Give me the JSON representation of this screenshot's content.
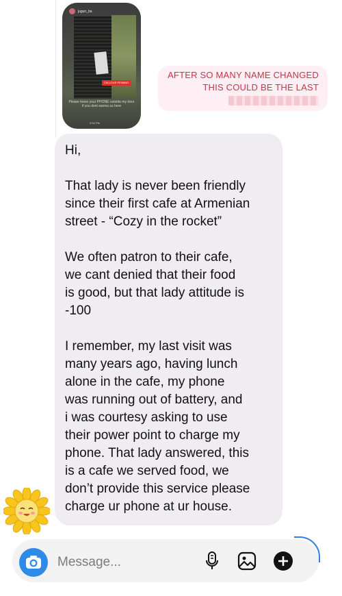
{
  "story": {
    "handle": "jugun_ba",
    "tag": "CALLOUS PENANG",
    "caption": "Please leave your PHONE outside my door if you dont wanna us here",
    "time": "9:54 PM"
  },
  "reply_quote": {
    "line1": "AFTER SO MANY NAME CHANGED",
    "line2": "THIS COULD BE THE LAST"
  },
  "message": {
    "paragraphs": [
      "Hi,",
      "That lady is never been friendly\nsince their first cafe at Armenian\nstreet - “Cozy in the rocket”",
      "We often patron to their cafe,\nwe cant denied that their food\nis good, but that lady attitude is\n-100",
      "I remember, my last visit was\nmany years ago, having lunch\nalone in the cafe, my phone\nwas running out of battery, and\ni was courtesy asking to use\ntheir power point to charge my\nphone. That lady answered, this\nis a cafe we served food, we\ndon’t provide this service please\ncharge ur phone at ur house."
    ]
  },
  "composer": {
    "placeholder": "Message..."
  },
  "icons": {
    "camera": "camera-icon",
    "mic": "microphone-icon",
    "gallery": "gallery-icon",
    "plus": "plus-icon",
    "sticker": "sunflower-sticker"
  },
  "colors": {
    "accent": "#2e8ce8",
    "quote_text": "#c8334a",
    "quote_bg": "#fdeff3",
    "bubble_bg": "#efedf1"
  }
}
